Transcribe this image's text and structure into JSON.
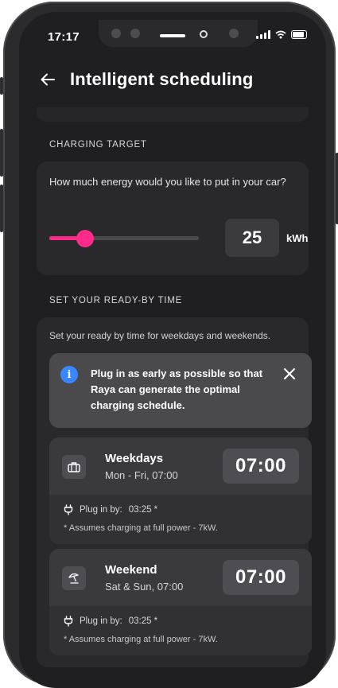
{
  "status_bar": {
    "time": "17:17"
  },
  "header": {
    "title": "Intelligent scheduling"
  },
  "charging_target": {
    "section_label": "CHARGING TARGET",
    "question": "How much energy would you like to put in your car?",
    "slider_fraction": 0.24,
    "value": "25",
    "unit": "kWh"
  },
  "ready_by": {
    "section_label": "SET YOUR READY-BY TIME",
    "description": "Set your ready by time for weekdays and weekends.",
    "info_message": "Plug in as early as possible so that Raya can generate the optimal charging schedule.",
    "schedules": [
      {
        "name": "Weekdays",
        "subtitle": "Mon - Fri, 07:00",
        "time": "07:00",
        "plug_label": "Plug in by:",
        "plug_time": "03:25 *",
        "note": "* Assumes charging at full power - 7kW.",
        "icon": "briefcase-icon"
      },
      {
        "name": "Weekend",
        "subtitle": "Sat & Sun, 07:00",
        "time": "07:00",
        "plug_label": "Plug in by:",
        "plug_time": "03:25 *",
        "note": "* Assumes charging at full power - 7kW.",
        "icon": "beach-umbrella-icon"
      }
    ]
  },
  "colors": {
    "accent": "#ff2a8a",
    "info": "#3a86ff",
    "background": "#1f1f21",
    "card": "#29292b"
  }
}
